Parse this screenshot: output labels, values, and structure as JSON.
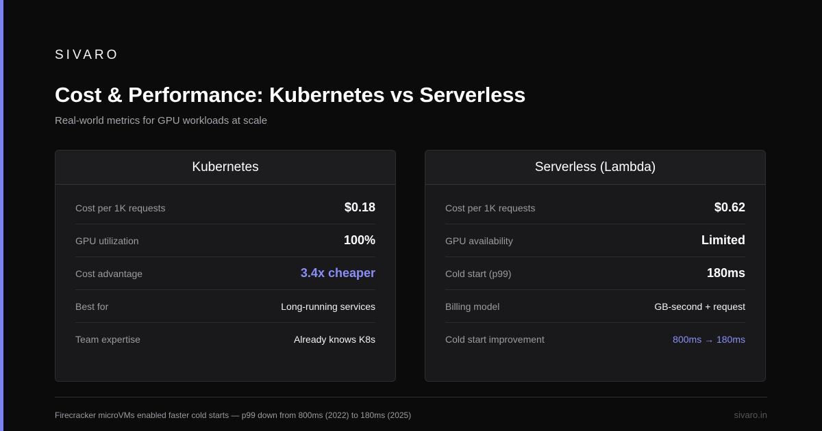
{
  "brand": "SIVARO",
  "title": "Cost & Performance: Kubernetes vs Serverless",
  "subtitle": "Real-world metrics for GPU workloads at scale",
  "colors": {
    "accent": "#7c83f0",
    "background": "#0b0b0c",
    "card": "#19191b"
  },
  "cards": [
    {
      "title": "Kubernetes",
      "rows": [
        {
          "label": "Cost per 1K requests",
          "value": "$0.18"
        },
        {
          "label": "GPU utilization",
          "value": "100%"
        },
        {
          "label": "Cost advantage",
          "value": "3.4x cheaper"
        },
        {
          "label": "Best for",
          "value": "Long-running services"
        },
        {
          "label": "Team expertise",
          "value": "Already knows K8s"
        }
      ]
    },
    {
      "title": "Serverless (Lambda)",
      "rows": [
        {
          "label": "Cost per 1K requests",
          "value": "$0.62"
        },
        {
          "label": "GPU availability",
          "value": "Limited"
        },
        {
          "label": "Cold start (p99)",
          "value": "180ms"
        },
        {
          "label": "Billing model",
          "value": "GB-second + request"
        },
        {
          "label": "Cold start improvement",
          "value": "800ms → 180ms"
        }
      ]
    }
  ],
  "footer": {
    "note": "Firecracker microVMs enabled faster cold starts — p99 down from 800ms (2022) to 180ms (2025)",
    "site": "sivaro.in"
  }
}
